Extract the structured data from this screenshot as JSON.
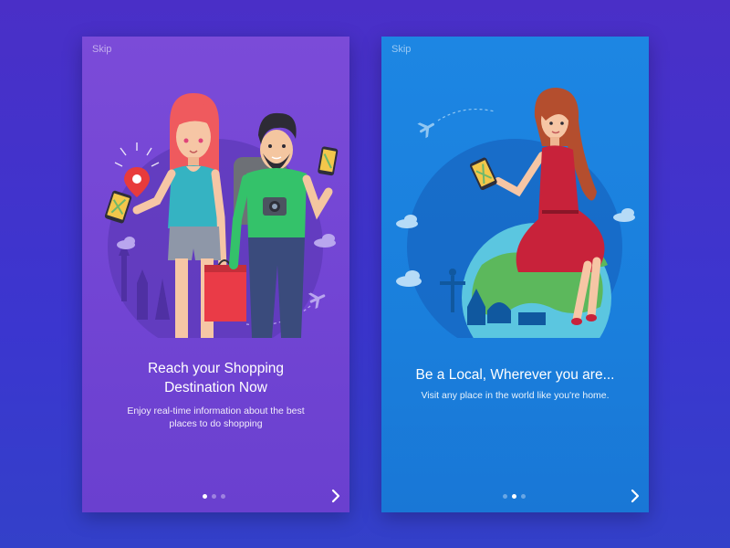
{
  "screens": [
    {
      "skip_label": "Skip",
      "title_line1": "Reach your Shopping",
      "title_line2": "Destination Now",
      "subtitle_line1": "Enjoy real-time information about the best",
      "subtitle_line2": "places to do shopping",
      "active_dot": 0,
      "background": "#7548d5"
    },
    {
      "skip_label": "Skip",
      "title_line1": "Be a Local, Wherever you are...",
      "subtitle_line1": "Visit any place in the world like you're home.",
      "active_dot": 1,
      "background": "#1b80de"
    }
  ],
  "page_background": "#3d36cc",
  "icons": [
    "chevron-right-icon",
    "map-pin-icon",
    "airplane-icon",
    "cloud-icon",
    "phone-icon",
    "camera-icon",
    "globe-icon",
    "shopping-bag-icon"
  ]
}
